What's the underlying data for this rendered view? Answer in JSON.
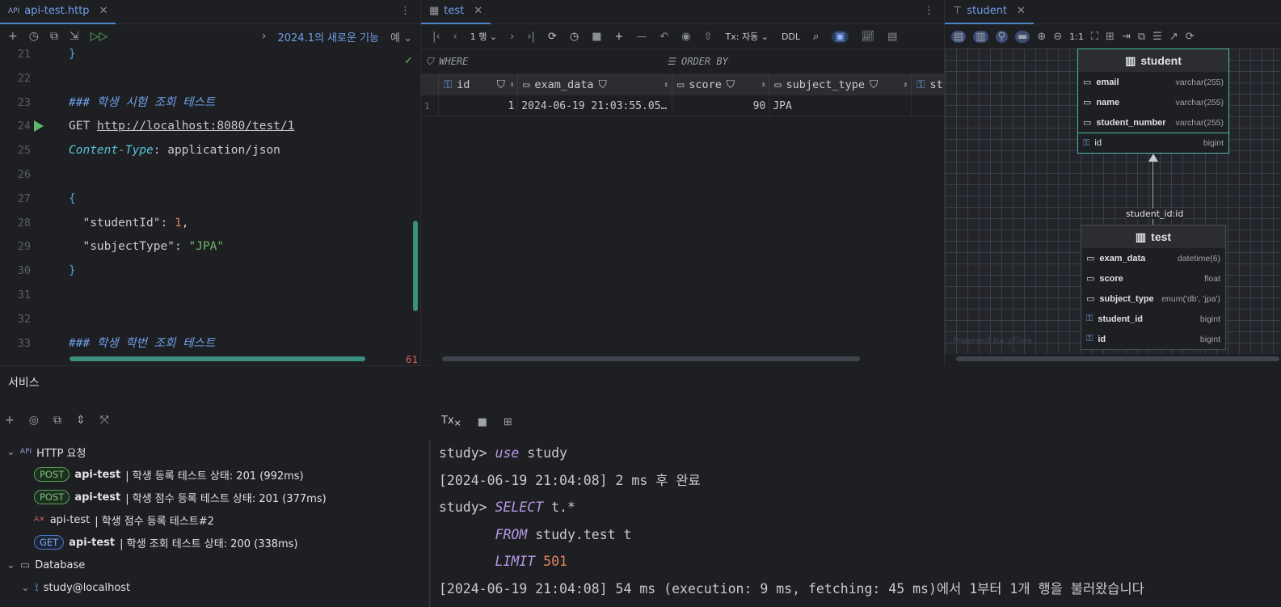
{
  "editor": {
    "tab_label": "api-test.http",
    "tab_icon_text": "API",
    "toolbar_news": "2024.1의 새로운 기능",
    "toolbar_yes": "예",
    "lines": [
      {
        "n": "21",
        "text": "}"
      },
      {
        "n": "22",
        "text": ""
      },
      {
        "n": "23",
        "text": "### 학생 시험 조회 테스트"
      },
      {
        "n": "24",
        "method": "GET",
        "url": "http://localhost:8080/test/1"
      },
      {
        "n": "25",
        "header": "Content-Type",
        "value": ": application/json"
      },
      {
        "n": "26",
        "text": ""
      },
      {
        "n": "27",
        "text": "{"
      },
      {
        "n": "28",
        "key": "\"studentId\"",
        "sep": ": ",
        "val": "1",
        "tail": ","
      },
      {
        "n": "29",
        "key": "\"subjectType\"",
        "sep": ": ",
        "val": "\"JPA\""
      },
      {
        "n": "30",
        "text": "}"
      },
      {
        "n": "31",
        "text": ""
      },
      {
        "n": "32",
        "text": ""
      },
      {
        "n": "33",
        "text": "### 학생 학번 조회 테스트"
      }
    ],
    "error_count": "61"
  },
  "table": {
    "tab_label": "test",
    "rows_label": "1 행",
    "tx_label": "Tx: 자동",
    "ddl_label": "DDL",
    "where_label": "WHERE",
    "orderby_label": "ORDER BY",
    "columns": [
      "id",
      "exam_data",
      "score",
      "subject_type",
      "st"
    ],
    "rows": [
      {
        "rownum": "1",
        "id": "1",
        "exam_data": "2024-06-19 21:03:55.05…",
        "score": "90",
        "subject_type": "JPA"
      }
    ]
  },
  "diagram": {
    "tab_label": "student",
    "zoom_label": "1:1",
    "relation_label": "student_id:id",
    "watermark": "Powered by yFiles",
    "student": {
      "title": "student",
      "fields": [
        {
          "name": "email",
          "type": "varchar(255)"
        },
        {
          "name": "name",
          "type": "varchar(255)"
        },
        {
          "name": "student_number",
          "type": "varchar(255)"
        },
        {
          "name": "id",
          "type": "bigint"
        }
      ]
    },
    "test": {
      "title": "test",
      "fields": [
        {
          "name": "exam_data",
          "type": "datetime(6)"
        },
        {
          "name": "score",
          "type": "float"
        },
        {
          "name": "subject_type",
          "type": "enum('db', 'jpa')"
        },
        {
          "name": "student_id",
          "type": "bigint"
        },
        {
          "name": "id",
          "type": "bigint"
        }
      ]
    }
  },
  "services": {
    "title": "서비스",
    "http_group": "HTTP 요청",
    "items": [
      {
        "method": "POST",
        "name": "api-test",
        "desc": "|  학생 등록 테스트 상태: 201 (992ms)"
      },
      {
        "method": "POST",
        "name": "api-test",
        "desc": "|  학생 점수 등록 테스트 상태: 201 (377ms)"
      },
      {
        "method": "",
        "name": "api-test",
        "desc": "| 학생 점수 등록 테스트#2"
      },
      {
        "method": "GET",
        "name": "api-test",
        "desc": "|  학생 조회 테스트 상태: 200 (338ms)"
      }
    ],
    "db_group": "Database",
    "db_item": "study@localhost"
  },
  "console": {
    "tx_label": "Tx",
    "lines": [
      {
        "prompt": "study> ",
        "kw": "use",
        "rest": " study"
      },
      {
        "text": "[2024-06-19 21:04:08] 2 ms 후 완료"
      },
      {
        "prompt": "study> ",
        "kw": "SELECT",
        "rest": " t.*"
      },
      {
        "indent": "       ",
        "kw": "FROM",
        "rest": " study.test t"
      },
      {
        "indent": "       ",
        "kw": "LIMIT",
        "num": " 501"
      },
      {
        "text": "[2024-06-19 21:04:08] 54 ms (execution: 9 ms, fetching: 45 ms)에서 1부터 1개 행을 불러왔습니다"
      }
    ]
  }
}
